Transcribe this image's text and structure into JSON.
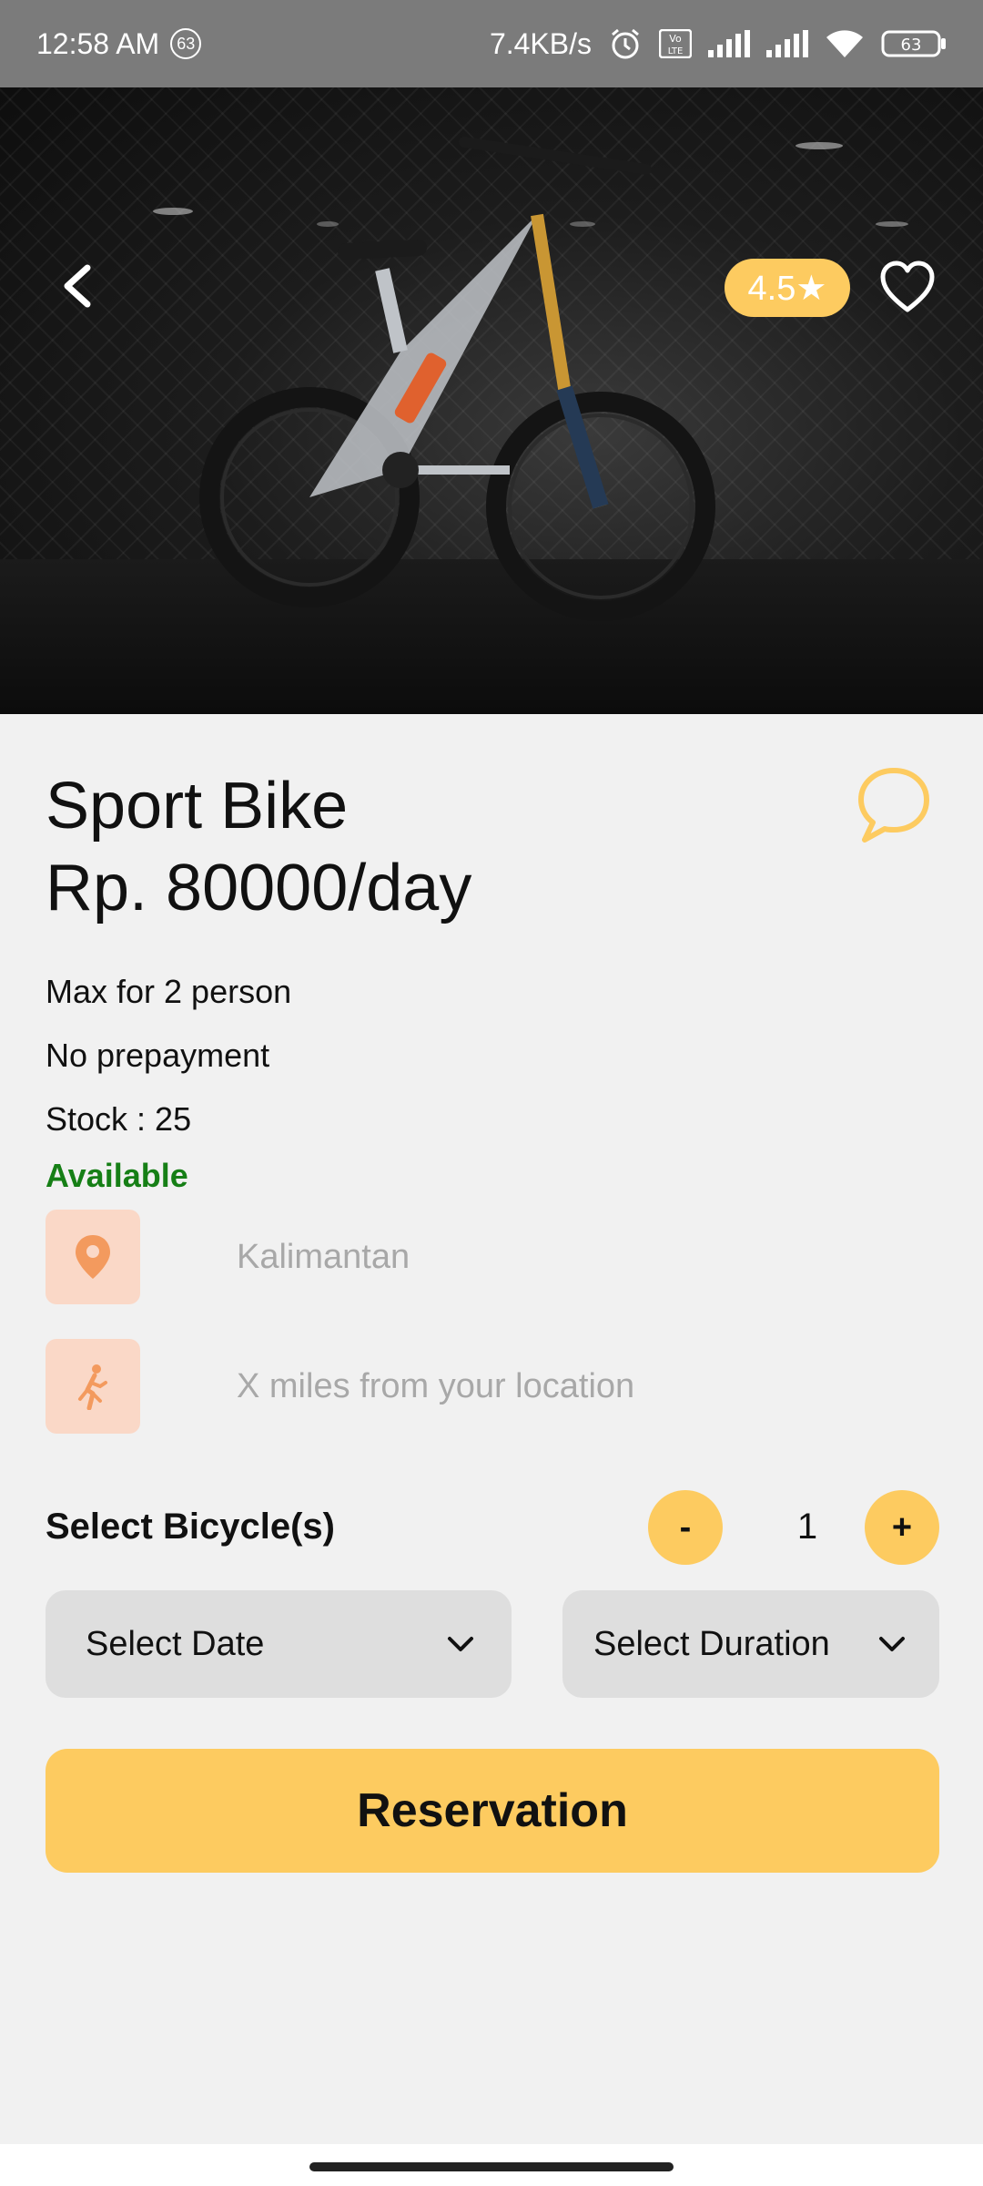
{
  "status_bar": {
    "time": "12:58 AM",
    "notif_count": "63",
    "net_speed": "7.4KB/s",
    "volte": "Vo LTE",
    "battery": "63"
  },
  "hero": {
    "rating": "4.5★"
  },
  "product": {
    "title": "Sport Bike",
    "price": "Rp. 80000/day",
    "max_person": "Max for 2 person",
    "prepayment": "No prepayment",
    "stock": "Stock : 25",
    "availability": "Available",
    "availability_color": "#167f16",
    "location": "Kalimantan",
    "distance": "X miles from your location"
  },
  "selector": {
    "label": "Select Bicycle(s)",
    "minus": "-",
    "quantity": "1",
    "plus": "+"
  },
  "dropdowns": {
    "date": "Select Date",
    "duration": "Select Duration"
  },
  "actions": {
    "reserve": "Reservation"
  },
  "colors": {
    "accent": "#fdcb60",
    "icon_bg": "#fad8c7",
    "icon_fg": "#f39a5e"
  }
}
